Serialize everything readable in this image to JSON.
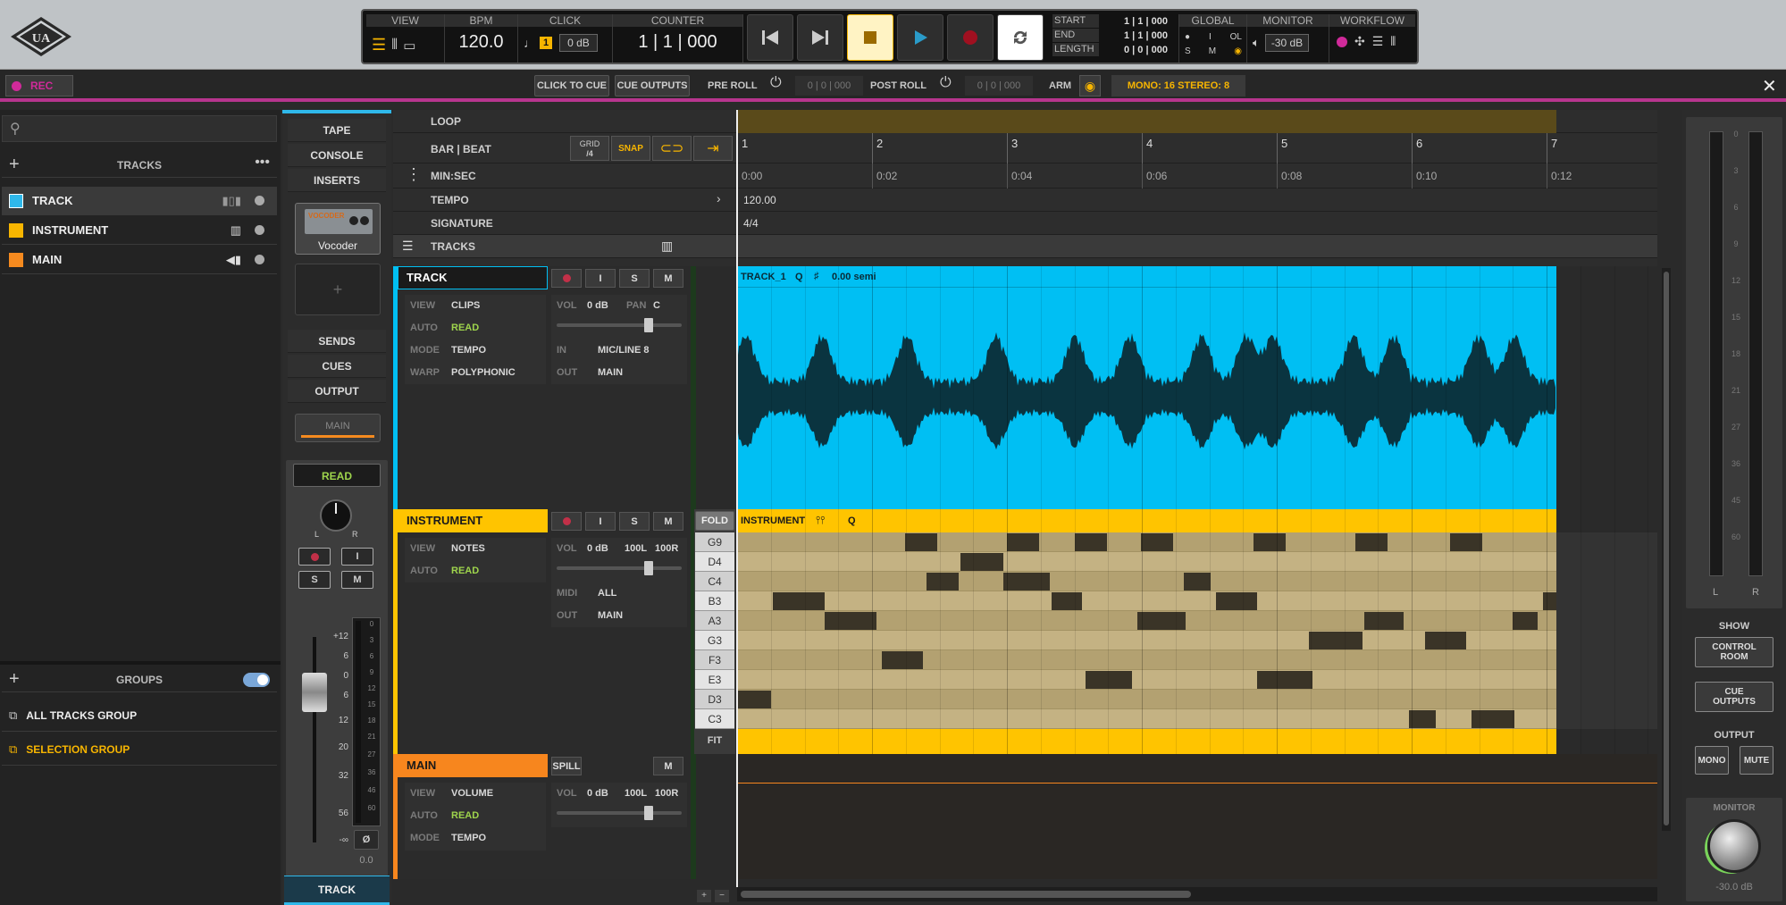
{
  "transport": {
    "view_label": "VIEW",
    "bpm_label": "BPM",
    "bpm_value": "120.0",
    "click_label": "CLICK",
    "click_level": "0 dB",
    "click_num": "1",
    "counter_label": "COUNTER",
    "counter_value": "1 | 1 | 000",
    "start_label": "START",
    "start_value": "1 | 1 | 000",
    "end_label": "END",
    "end_value": "1 | 1 | 000",
    "length_label": "LENGTH",
    "length_value": "0 | 0 | 000",
    "global_label": "GLOBAL",
    "global_i": "I",
    "global_ol": "OL",
    "global_s": "S",
    "global_m": "M",
    "monitor_label": "MONITOR",
    "monitor_value": "-30 dB",
    "workflow_label": "WORKFLOW"
  },
  "secbar": {
    "rec_label": "REC",
    "click_to_cue": "CLICK TO CUE",
    "cue_outputs": "CUE OUTPUTS",
    "preroll_label": "PRE ROLL",
    "preroll_value": "0 | 0 | 000",
    "postroll_label": "POST ROLL",
    "postroll_value": "0 | 0 | 000",
    "arm_label": "ARM",
    "mono_stereo": "MONO: 16  STEREO: 8"
  },
  "left": {
    "tracks_header": "TRACKS",
    "tracks": [
      {
        "name": "TRACK",
        "color": "#2fb8ea"
      },
      {
        "name": "INSTRUMENT",
        "color": "#f7b500"
      },
      {
        "name": "MAIN",
        "color": "#f58a1f"
      }
    ],
    "groups_header": "GROUPS",
    "groups": [
      {
        "name": "ALL TRACKS GROUP",
        "color": "#cfcfcf"
      },
      {
        "name": "SELECTION GROUP",
        "color": "#f7b500"
      }
    ]
  },
  "inserts": {
    "tape": "TAPE",
    "console": "CONSOLE",
    "inserts": "INSERTS",
    "plugin_name": "Vocoder",
    "plugin_brand": "VOCODER",
    "sends": "SENDS",
    "cues": "CUES",
    "output": "OUTPUT",
    "output_value": "MAIN",
    "auto_mode": "READ",
    "pan_l": "L",
    "pan_r": "R",
    "btn_s": "S",
    "btn_m": "M",
    "btn_i": "I",
    "fader_scale": [
      "+12",
      "6",
      "0",
      "6",
      "12",
      "20",
      "32",
      "56",
      "-∞"
    ],
    "meter_scale": [
      "0",
      "3",
      "6",
      "9",
      "12",
      "15",
      "18",
      "21",
      "27",
      "36",
      "46",
      "60"
    ],
    "phase": "Ø",
    "fader_value": "0.0",
    "selected_track": "TRACK"
  },
  "timeline": {
    "loop": "LOOP",
    "bar_beat": "BAR | BEAT",
    "grid_label": "GRID",
    "grid_value": "/4",
    "snap": "SNAP",
    "min_sec": "MIN:SEC",
    "tempo": "TEMPO",
    "tempo_value": "120.00",
    "signature": "SIGNATURE",
    "signature_value": "4/4",
    "tracks": "TRACKS",
    "bars": [
      "1",
      "2",
      "3",
      "4",
      "5",
      "6",
      "7"
    ],
    "times": [
      "0:00",
      "0:02",
      "0:04",
      "0:06",
      "0:08",
      "0:10",
      "0:12"
    ]
  },
  "track1": {
    "name": "TRACK",
    "view_k": "VIEW",
    "view_v": "CLIPS",
    "auto_k": "AUTO",
    "auto_v": "READ",
    "mode_k": "MODE",
    "mode_v": "TEMPO",
    "warp_k": "WARP",
    "warp_v": "POLYPHONIC",
    "vol_k": "VOL",
    "vol_v": "0 dB",
    "pan_k": "PAN",
    "pan_v": "C",
    "in_k": "IN",
    "in_v": "MIC/LINE 8",
    "out_k": "OUT",
    "out_v": "MAIN",
    "btn_i": "I",
    "btn_s": "S",
    "btn_m": "M",
    "clip_name": "TRACK_1",
    "clip_q": "Q",
    "clip_sharp": "♯",
    "clip_semi": "0.00 semi"
  },
  "track2": {
    "name": "INSTRUMENT",
    "view_k": "VIEW",
    "view_v": "NOTES",
    "auto_k": "AUTO",
    "auto_v": "READ",
    "vol_k": "VOL",
    "vol_v": "0 dB",
    "pan_l": "100L",
    "pan_r": "100R",
    "midi_k": "MIDI",
    "midi_v": "ALL",
    "out_k": "OUT",
    "out_v": "MAIN",
    "btn_i": "I",
    "btn_s": "S",
    "btn_m": "M",
    "fold": "FOLD",
    "fit": "FIT",
    "clip_name": "INSTRUMENT",
    "clip_q": "Q",
    "notes": [
      "G9",
      "D4",
      "C4",
      "B3",
      "A3",
      "G3",
      "F3",
      "E3",
      "D3",
      "C3"
    ]
  },
  "track3": {
    "name": "MAIN",
    "spill": "SPILL",
    "btn_m": "M",
    "view_k": "VIEW",
    "view_v": "VOLUME",
    "auto_k": "AUTO",
    "auto_v": "READ",
    "mode_k": "MODE",
    "mode_v": "TEMPO",
    "vol_k": "VOL",
    "vol_v": "0 dB",
    "pan_l": "100L",
    "pan_r": "100R"
  },
  "right": {
    "meter_scale": [
      "0",
      "3",
      "6",
      "9",
      "12",
      "15",
      "18",
      "21",
      "27",
      "36",
      "45",
      "60"
    ],
    "meter_l": "L",
    "meter_r": "R",
    "show": "SHOW",
    "control_room": "CONTROL ROOM",
    "cue_outputs": "CUE OUTPUTS",
    "output": "OUTPUT",
    "mono": "MONO",
    "mute": "MUTE",
    "monitor": "MONITOR",
    "monitor_value": "-30.0 dB"
  },
  "colors": {
    "track_blue": "#00bff3",
    "instrument_yellow": "#ffc400",
    "main_orange": "#f7861e",
    "rec_magenta": "#b7358e",
    "green_auto": "#9ed44c"
  }
}
